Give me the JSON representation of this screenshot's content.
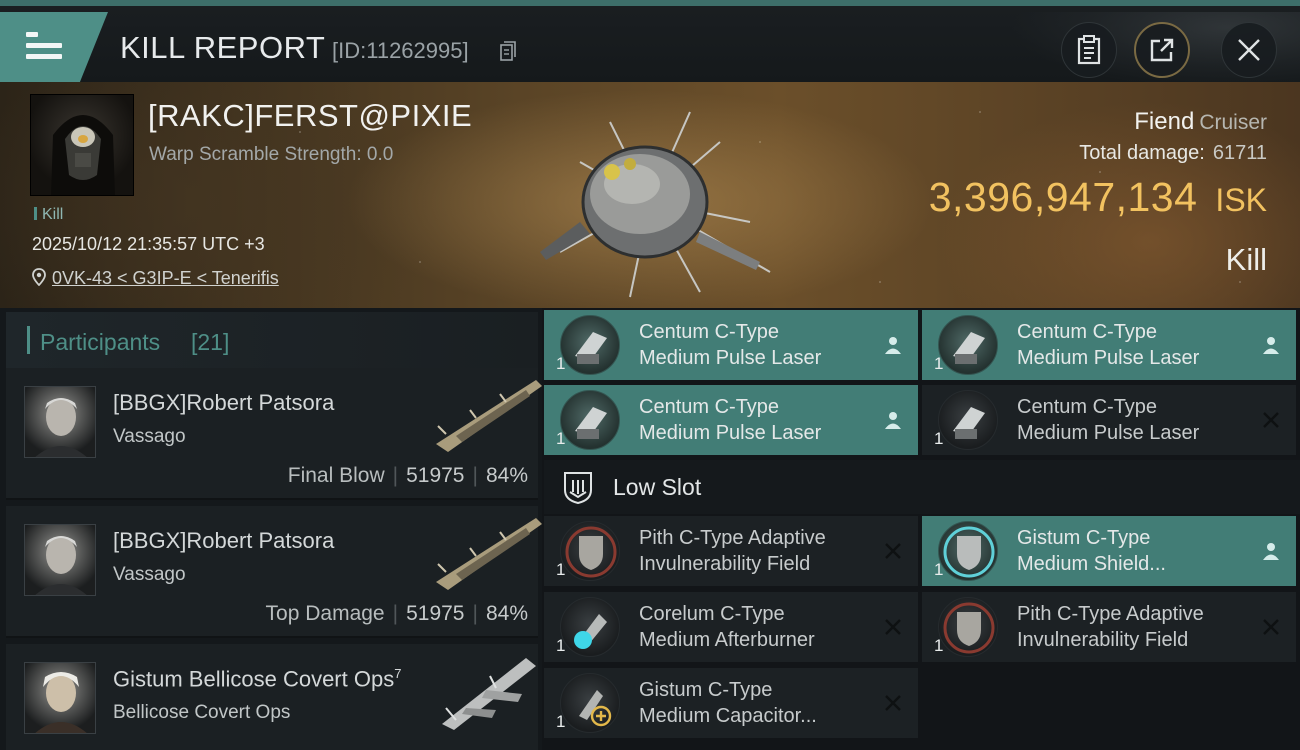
{
  "header": {
    "title": "KILL REPORT",
    "report_id": "[ID:11262995]"
  },
  "victim": {
    "name": "[RAKC]FERST@PIXIE",
    "warp_scramble": "Warp Scramble Strength: 0.0",
    "tag": "Kill",
    "datetime": "2025/10/12 21:35:57 UTC +3",
    "location": "0VK-43 < G3IP-E < Tenerifis"
  },
  "ship": {
    "name": "Fiend",
    "class": "Cruiser",
    "total_damage_label": "Total damage:",
    "total_damage": "61711",
    "isk_value": "3,396,947,134",
    "isk_unit": "ISK",
    "result": "Kill"
  },
  "participants": {
    "title": "Participants",
    "count": "[21]",
    "items": [
      {
        "name": "[BBGX]Robert Patsora",
        "ship": "Vassago",
        "label": "Final Blow",
        "damage": "51975",
        "percent": "84%"
      },
      {
        "name": "[BBGX]Robert Patsora",
        "ship": "Vassago",
        "label": "Top Damage",
        "damage": "51975",
        "percent": "84%"
      },
      {
        "name": "Gistum Bellicose Covert Ops",
        "name_sup": "7",
        "ship": "Bellicose Covert Ops"
      }
    ]
  },
  "modules": {
    "high": [
      {
        "line1": "Centum C-Type",
        "line2": "Medium Pulse Laser",
        "qty": "1",
        "status": "pilot-icon",
        "fitted": true
      },
      {
        "line1": "Centum C-Type",
        "line2": "Medium Pulse Laser",
        "qty": "1",
        "status": "pilot-icon",
        "fitted": true
      },
      {
        "line1": "Centum C-Type",
        "line2": "Medium Pulse Laser",
        "qty": "1",
        "status": "pilot-icon",
        "fitted": true
      },
      {
        "line1": "Centum C-Type",
        "line2": "Medium Pulse Laser",
        "qty": "1",
        "status": "destroyed-icon",
        "fitted": false
      }
    ],
    "low_slot_label": "Low Slot",
    "low": [
      {
        "line1": "Pith C-Type Adaptive",
        "line2": "Invulnerability Field",
        "qty": "1",
        "status": "destroyed-icon",
        "fitted": false
      },
      {
        "line1": "Gistum C-Type",
        "line2": "Medium Shield...",
        "qty": "1",
        "status": "pilot-icon",
        "fitted": true
      },
      {
        "line1": "Corelum C-Type",
        "line2": "Medium Afterburner",
        "qty": "1",
        "status": "destroyed-icon",
        "fitted": false
      },
      {
        "line1": "Pith C-Type Adaptive",
        "line2": "Invulnerability Field",
        "qty": "1",
        "status": "destroyed-icon",
        "fitted": false
      },
      {
        "line1": "Gistum C-Type",
        "line2": "Medium Capacitor...",
        "qty": "1",
        "status": "destroyed-icon",
        "fitted": false
      }
    ]
  },
  "colors": {
    "accent": "#4e8f87",
    "fitted_bg": "#427d76",
    "isk": "#f2c260"
  }
}
